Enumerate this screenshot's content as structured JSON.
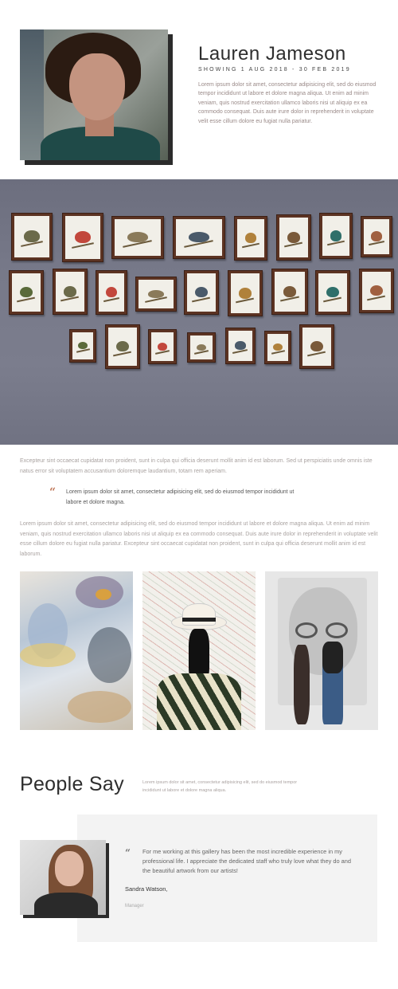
{
  "hero": {
    "name": "Lauren Jameson",
    "dates": "SHOWING 1 AUG 2018 - 30 FEB 2019",
    "body": "Lorem ipsum dolor sit amet, consectetur adipisicing elit, sed do eiusmod tempor incididunt ut labore et dolore magna aliqua. Ut enim ad minim veniam, quis nostrud exercitation ullamco laboris nisi ut aliquip ex ea commodo consequat. Duis aute irure dolor in reprehenderit in voluptate velit esse cillum dolore eu fugiat nulla pariatur."
  },
  "article": {
    "intro": "Excepteur sint occaecat cupidatat non proident, sunt in culpa qui officia deserunt mollit anim id est laborum. Sed ut perspiciatis unde omnis iste natus error sit voluptatem accusantium doloremque laudantium, totam rem aperiam.",
    "quote": "Lorem ipsum dolor sit amet, consectetur adipisicing elit, sed do eiusmod tempor incididunt ut labore et dolore magna.",
    "body": "Lorem ipsum dolor sit amet, consectetur adipisicing elit, sed do eiusmod tempor incididunt ut labore et dolore magna aliqua. Ut enim ad minim veniam, quis nostrud exercitation ullamco laboris nisi ut aliquip ex ea commodo consequat. Duis aute irure dolor in reprehenderit in voluptate velit esse cillum dolore eu fugiat nulla pariatur. Excepteur sint occaecat cupidatat non proident, sunt in culpa qui officia deserunt mollit anim id est laborum."
  },
  "people": {
    "title": "People Say",
    "subtitle": "Lorem ipsum dolor sit amet, consectetur adipisicing elit, sed do eiusmod tempor incididunt ut labore et dolore magna aliqua.",
    "testimonial": {
      "text": "For me working at this gallery has been the most incredible experience in my professional life. I appreciate the dedicated staff who truly love what they do and the beautiful artwork from our artists!",
      "name": "Sandra Watson,",
      "role": "Manager"
    }
  },
  "colors": {
    "accent": "#c0785a",
    "wall": "#777989",
    "frame": "#5c3322",
    "testimonial_bg": "#f3f3f3"
  },
  "icons": {
    "quote": "quote-icon"
  }
}
